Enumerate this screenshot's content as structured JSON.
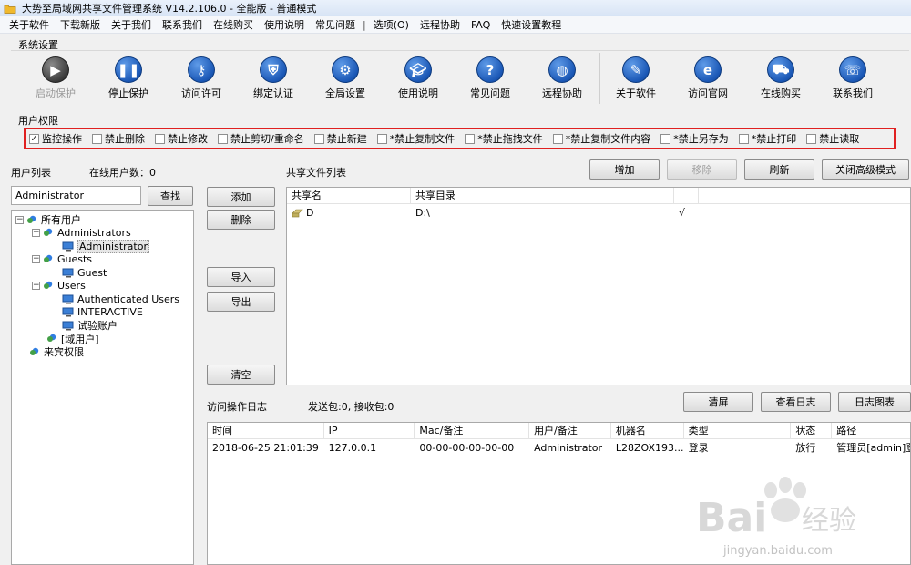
{
  "window": {
    "title": "大势至局域网共享文件管理系统 V14.2.106.0 - 全能版 - 普通模式"
  },
  "menu": {
    "items": [
      "关于软件",
      "下载新版",
      "关于我们",
      "联系我们",
      "在线购买",
      "使用说明",
      "常见问题"
    ],
    "separator": "|",
    "items2": [
      "选项(O)",
      "远程协助",
      "FAQ",
      "快速设置教程"
    ]
  },
  "system_settings": {
    "title": "系统设置",
    "buttons": [
      {
        "label": "启动保护",
        "icon": "play-icon",
        "enabled": false
      },
      {
        "label": "停止保护",
        "icon": "pause-icon",
        "enabled": true
      },
      {
        "label": "访问许可",
        "icon": "key-icon",
        "enabled": true
      },
      {
        "label": "绑定认证",
        "icon": "shield-icon",
        "enabled": true
      },
      {
        "label": "全局设置",
        "icon": "gear-icon",
        "enabled": true
      },
      {
        "label": "使用说明",
        "icon": "graduation-cap-icon",
        "enabled": true
      },
      {
        "label": "常见问题",
        "icon": "question-icon",
        "enabled": true
      },
      {
        "label": "远程协助",
        "icon": "globe-icon",
        "enabled": true
      },
      {
        "label": "关于软件",
        "icon": "info-icon",
        "enabled": true
      },
      {
        "label": "访问官网",
        "icon": "browser-icon",
        "enabled": true
      },
      {
        "label": "在线购买",
        "icon": "cart-icon",
        "enabled": true
      },
      {
        "label": "联系我们",
        "icon": "phone-icon",
        "enabled": true
      }
    ]
  },
  "permissions": {
    "title": "用户权限",
    "items": [
      {
        "label": "监控操作",
        "checked": true
      },
      {
        "label": "禁止删除",
        "checked": false
      },
      {
        "label": "禁止修改",
        "checked": false
      },
      {
        "label": "禁止剪切/重命名",
        "checked": false
      },
      {
        "label": "禁止新建",
        "checked": false
      },
      {
        "label": "*禁止复制文件",
        "checked": false
      },
      {
        "label": "*禁止拖拽文件",
        "checked": false
      },
      {
        "label": "*禁止复制文件内容",
        "checked": false
      },
      {
        "label": "*禁止另存为",
        "checked": false
      },
      {
        "label": "*禁止打印",
        "checked": false
      },
      {
        "label": "禁止读取",
        "checked": false
      }
    ]
  },
  "user_list": {
    "title": "用户列表",
    "online_label": "在线用户数：",
    "online_count": "0",
    "search_value": "Administrator",
    "search_button": "查找",
    "tree": {
      "root": "所有用户",
      "groups": [
        {
          "name": "Administrators",
          "children": [
            "Administrator"
          ]
        },
        {
          "name": "Guests",
          "children": [
            "Guest"
          ]
        },
        {
          "name": "Users",
          "children": [
            "Authenticated Users",
            "INTERACTIVE",
            "试验账户"
          ]
        }
      ],
      "domain_users": "[域用户]",
      "guest_permission": "来宾权限"
    }
  },
  "mid_buttons": {
    "add": "添加",
    "delete": "删除",
    "import": "导入",
    "export": "导出",
    "clear": "清空"
  },
  "share_list": {
    "title": "共享文件列表",
    "buttons": {
      "add": "增加",
      "remove": "移除",
      "refresh": "刷新",
      "advanced": "关闭高级模式"
    },
    "columns": [
      "共享名",
      "共享目录",
      ""
    ],
    "rows": [
      {
        "name": "D",
        "path": "D:\\",
        "flag": "√"
      }
    ]
  },
  "log": {
    "title": "访问操作日志",
    "packets": "发送包:0, 接收包:0",
    "buttons": {
      "clear": "清屏",
      "view": "查看日志",
      "chart": "日志图表"
    },
    "columns": [
      "时间",
      "IP",
      "Mac/备注",
      "用户/备注",
      "机器名",
      "类型",
      "状态",
      "路径"
    ],
    "rows": [
      {
        "time": "2018-06-25 21:01:39",
        "ip": "127.0.0.1",
        "mac": "00-00-00-00-00-00",
        "user": "Administrator",
        "machine": "L28ZOX193...",
        "type": "登录",
        "status": "放行",
        "path": "管理员[admin]登"
      }
    ]
  },
  "watermark": {
    "brand": "Bai",
    "brand_tail": "经验",
    "url": "jingyan.baidu.com"
  }
}
